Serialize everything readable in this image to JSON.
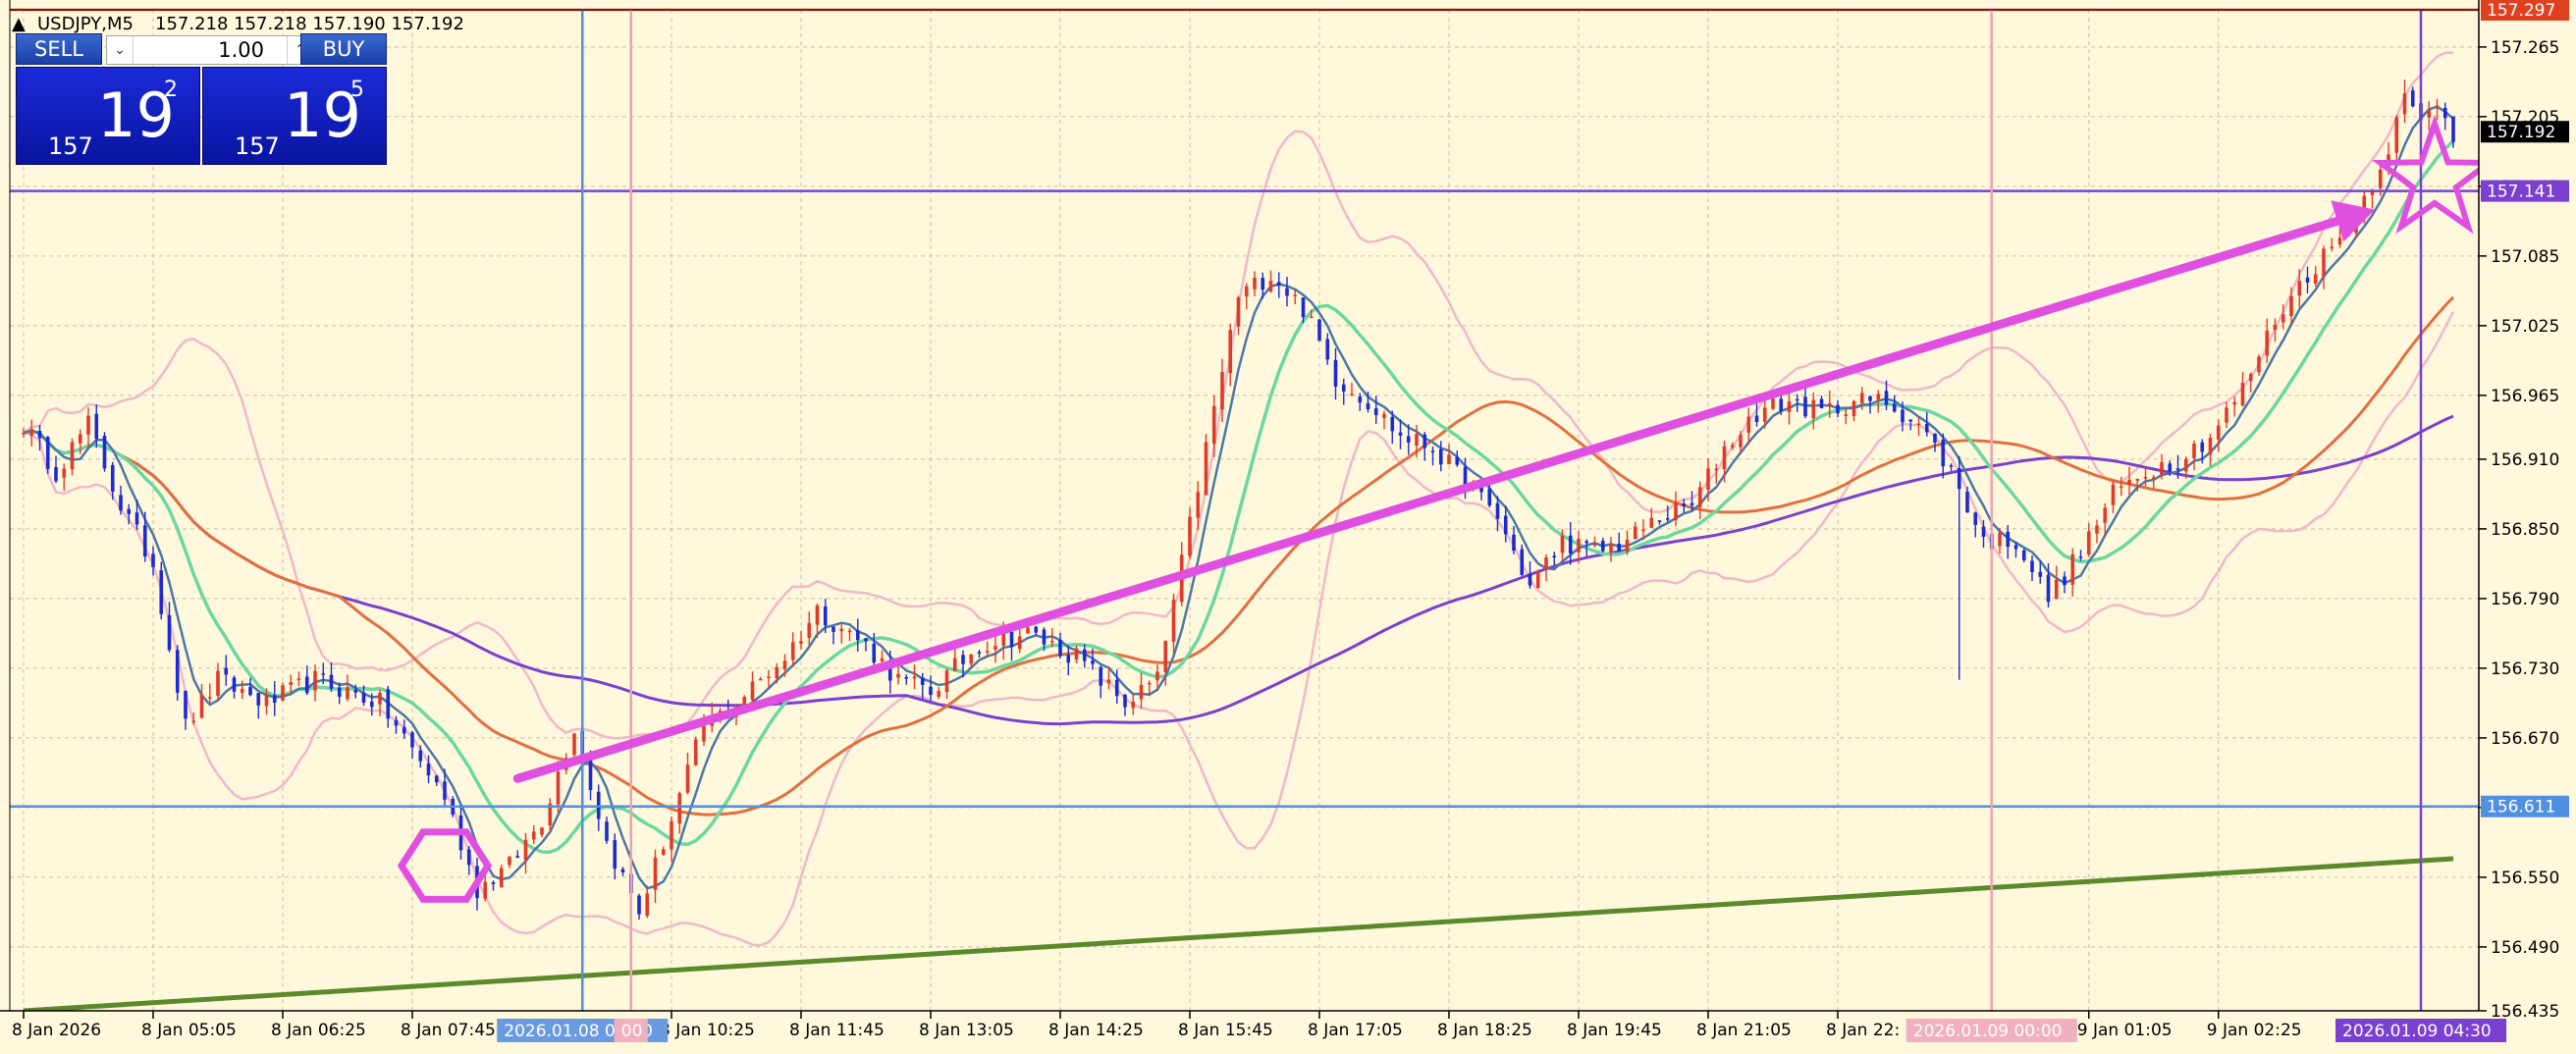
{
  "header": {
    "symbol": "USDJPY,M5",
    "ohlc": "157.218 157.218 157.190 157.192"
  },
  "trade_panel": {
    "sell_label": "SELL",
    "buy_label": "BUY",
    "lot_value": "1.00",
    "sell_price": {
      "prefix": "157",
      "big": "19",
      "sup": "2"
    },
    "buy_price": {
      "prefix": "157",
      "big": "19",
      "sup": "5"
    }
  },
  "colors": {
    "background": "#fff8dc",
    "bull": "#e03a2a",
    "bear": "#1a2ad8",
    "grid": "#c8c0a0",
    "ma_fast": "#4a78a8",
    "ma_mid": "#6ad8a0",
    "ma_slow": "#e07040",
    "ma_long": "#7a40d0",
    "bollinger": "#f0b8c8",
    "trendline": "#5a8a2a",
    "annotation": "#e050e0",
    "hline_top": "#e04020",
    "hline_purple": "#7a40d0",
    "hline_blue": "#5090e0"
  },
  "chart_data": {
    "type": "candlestick",
    "ylim": [
      156.435,
      157.297
    ],
    "y_ticks": [
      157.265,
      157.205,
      157.145,
      157.085,
      157.025,
      156.965,
      156.91,
      156.85,
      156.79,
      156.73,
      156.67,
      156.61,
      156.55,
      156.49,
      156.435
    ],
    "y_tick_labels": [
      "157.265",
      "157.205",
      "157.145",
      "157.085",
      "157.025",
      "156.965",
      "156.910",
      "156.850",
      "156.790",
      "156.730",
      "156.670",
      "156.610",
      "156.550",
      "156.490",
      "156.435"
    ],
    "x_ticks": [
      {
        "index": 0,
        "label": "8 Jan 2026"
      },
      {
        "index": 16,
        "label": "8 Jan 05:05"
      },
      {
        "index": 32,
        "label": "8 Jan 06:25"
      },
      {
        "index": 48,
        "label": "8 Jan 07:45"
      },
      {
        "index": 80,
        "label": "8 Jan 10:25"
      },
      {
        "index": 96,
        "label": "8 Jan 11:45"
      },
      {
        "index": 112,
        "label": "8 Jan 13:05"
      },
      {
        "index": 128,
        "label": "8 Jan 14:25"
      },
      {
        "index": 144,
        "label": "8 Jan 15:45"
      },
      {
        "index": 160,
        "label": "8 Jan 17:05"
      },
      {
        "index": 176,
        "label": "8 Jan 18:25"
      },
      {
        "index": 192,
        "label": "8 Jan 19:45"
      },
      {
        "index": 208,
        "label": "8 Jan 21:05"
      },
      {
        "index": 224,
        "label": "8 Jan 22:"
      },
      {
        "index": 255,
        "label": "9 Jan 01:05"
      },
      {
        "index": 271,
        "label": "9 Jan 02:25"
      }
    ],
    "vlines": [
      {
        "index": 69,
        "label": "2026.01.08 09:40",
        "color": "#5090e0",
        "badge_bg": "#6a9ae0"
      },
      {
        "index": 75,
        "label": "00",
        "color": "#f0a0b0",
        "badge_bg": "#f0b0c0"
      },
      {
        "index": 243,
        "label": "2026.01.09 00:00",
        "color": "#f0a0b0",
        "badge_bg": "#f0b0c0"
      },
      {
        "index": 296,
        "label": "2026.01.09 04:30",
        "color": "#7a40d0",
        "badge_bg": "#7a40d0"
      }
    ],
    "hlines": [
      {
        "price": 157.297,
        "label": "157.297",
        "color": "#e04020"
      },
      {
        "price": 157.141,
        "label": "157.141",
        "color": "#7a40d0"
      },
      {
        "price": 156.611,
        "label": "156.611",
        "color": "#5090e0"
      }
    ],
    "current_price": {
      "price": 157.192,
      "label": "157.192"
    },
    "anchors": [
      [
        0,
        156.94
      ],
      [
        4,
        156.9
      ],
      [
        8,
        156.94
      ],
      [
        12,
        156.87
      ],
      [
        16,
        156.82
      ],
      [
        20,
        156.68
      ],
      [
        24,
        156.72
      ],
      [
        30,
        156.7
      ],
      [
        36,
        156.72
      ],
      [
        44,
        156.7
      ],
      [
        52,
        156.62
      ],
      [
        56,
        156.54
      ],
      [
        60,
        156.56
      ],
      [
        64,
        156.6
      ],
      [
        68,
        156.68
      ],
      [
        72,
        156.58
      ],
      [
        76,
        156.52
      ],
      [
        80,
        156.6
      ],
      [
        84,
        156.68
      ],
      [
        88,
        156.7
      ],
      [
        94,
        156.74
      ],
      [
        98,
        156.78
      ],
      [
        104,
        156.75
      ],
      [
        108,
        156.72
      ],
      [
        112,
        156.71
      ],
      [
        118,
        156.75
      ],
      [
        124,
        156.76
      ],
      [
        130,
        156.74
      ],
      [
        136,
        156.7
      ],
      [
        140,
        156.72
      ],
      [
        143,
        156.82
      ],
      [
        146,
        156.92
      ],
      [
        150,
        157.05
      ],
      [
        154,
        157.07
      ],
      [
        158,
        157.04
      ],
      [
        162,
        156.98
      ],
      [
        166,
        156.96
      ],
      [
        170,
        156.93
      ],
      [
        174,
        156.92
      ],
      [
        178,
        156.89
      ],
      [
        182,
        156.86
      ],
      [
        186,
        156.8
      ],
      [
        190,
        156.84
      ],
      [
        194,
        156.83
      ],
      [
        198,
        156.84
      ],
      [
        202,
        156.86
      ],
      [
        206,
        156.87
      ],
      [
        210,
        156.92
      ],
      [
        214,
        156.95
      ],
      [
        218,
        156.96
      ],
      [
        222,
        156.95
      ],
      [
        226,
        156.96
      ],
      [
        230,
        156.96
      ],
      [
        234,
        156.94
      ],
      [
        238,
        156.9
      ],
      [
        242,
        156.84
      ],
      [
        246,
        156.84
      ],
      [
        250,
        156.79
      ],
      [
        254,
        156.83
      ],
      [
        258,
        156.88
      ],
      [
        262,
        156.9
      ],
      [
        266,
        156.91
      ],
      [
        270,
        156.93
      ],
      [
        274,
        156.97
      ],
      [
        278,
        157.03
      ],
      [
        282,
        157.07
      ],
      [
        286,
        157.1
      ],
      [
        288,
        157.12
      ],
      [
        290,
        157.15
      ],
      [
        292,
        157.18
      ],
      [
        294,
        157.22
      ],
      [
        296,
        157.2
      ],
      [
        298,
        157.22
      ],
      [
        300,
        157.19
      ]
    ],
    "spikes": [
      {
        "index": 243,
        "low": 156.63
      },
      {
        "index": 75,
        "low": 156.475
      },
      {
        "index": 239,
        "low": 156.72
      }
    ],
    "indicators": {
      "ma_fast_period": 5,
      "ma_mid_period": 13,
      "ma_slow_period": 40,
      "ma_long_period": 110,
      "bollinger_period": 20
    },
    "trendline_green": {
      "from": [
        0,
        156.435
      ],
      "to": [
        300,
        156.566
      ]
    },
    "annotations": {
      "arrow": {
        "from": [
          61,
          156.635
        ],
        "to": [
          288,
          157.12
        ]
      },
      "hexagon": {
        "index": 52,
        "price": 156.56
      },
      "star": {
        "index": 296,
        "price": 157.15
      }
    }
  }
}
